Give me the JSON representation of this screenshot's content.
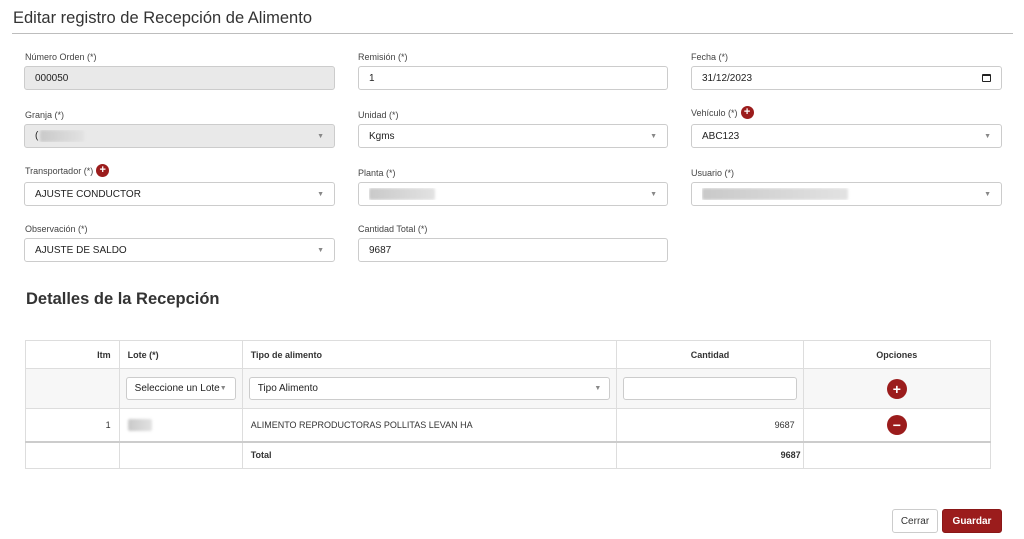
{
  "page": {
    "title": "Editar registro de Recepción de Alimento"
  },
  "form": {
    "numero_orden": {
      "label": "Número Orden (*)",
      "value": "000050"
    },
    "remision": {
      "label": "Remisión (*)",
      "value": "1"
    },
    "fecha": {
      "label": "Fecha (*)",
      "value": "31/12/2023"
    },
    "granja": {
      "label": "Granja (*)",
      "value": "("
    },
    "unidad": {
      "label": "Unidad (*)",
      "value": "Kgms"
    },
    "vehiculo": {
      "label": "Vehículo (*)",
      "value": "ABC123"
    },
    "transportador": {
      "label": "Transportador (*)",
      "value": "AJUSTE CONDUCTOR"
    },
    "planta": {
      "label": "Planta (*)",
      "value": ""
    },
    "usuario": {
      "label": "Usuario (*)",
      "value": ""
    },
    "observacion": {
      "label": "Observación (*)",
      "value": "AJUSTE DE SALDO"
    },
    "cantidad_total": {
      "label": "Cantidad Total (*)",
      "value": "9687"
    }
  },
  "details": {
    "title": "Detalles de la Recepción",
    "columns": {
      "itm": "Itm",
      "lote": "Lote (*)",
      "tipo": "Tipo de alimento",
      "cantidad": "Cantidad",
      "opciones": "Opciones"
    },
    "new_row": {
      "lote_placeholder": "Seleccione un Lote",
      "tipo_placeholder": "Tipo Alimento",
      "cantidad_value": ""
    },
    "rows": [
      {
        "itm": "1",
        "lote": "",
        "tipo": "ALIMENTO REPRODUCTORAS POLLITAS LEVAN HA",
        "cantidad": "9687"
      }
    ],
    "total": {
      "label": "Total",
      "value": "9687"
    }
  },
  "buttons": {
    "cerrar": "Cerrar",
    "guardar": "Guardar"
  },
  "colors": {
    "accent": "#9b1c1c",
    "border": "#cccccc",
    "disabled_bg": "#e9e9e9"
  },
  "icons": {
    "add": "plus-circle-icon",
    "remove": "minus-circle-icon",
    "calendar": "calendar-icon",
    "dropdown": "chevron-down-icon"
  }
}
